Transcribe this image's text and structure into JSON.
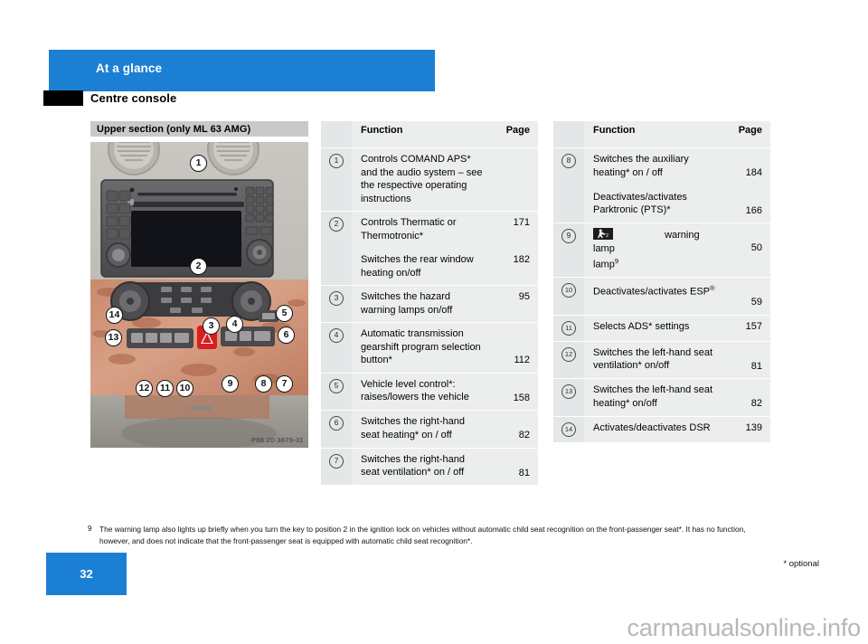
{
  "header": {
    "chapter_title": "At a glance",
    "section_title": "Centre console",
    "banner_color": "#1b7fd4"
  },
  "figure": {
    "caption": "Upper section (only ML 63 AMG)",
    "photo_code": "P68 20-3879-31",
    "callouts": [
      "1",
      "2",
      "3",
      "4",
      "5",
      "6",
      "7",
      "8",
      "9",
      "10",
      "11",
      "12",
      "13",
      "14"
    ]
  },
  "tables": {
    "columns": {
      "function": "Function",
      "page": "Page"
    },
    "left": [
      {
        "num": "1",
        "lines": [
          {
            "text": "Controls COMAND APS* and the audio system – see the respective operating instructions",
            "page": ""
          }
        ]
      },
      {
        "num": "2",
        "lines": [
          {
            "text": "Controls Thermatic or Thermotronic*",
            "page": "171"
          },
          {
            "text": "Switches the rear window heating on/off",
            "page": "182"
          }
        ]
      },
      {
        "num": "3",
        "lines": [
          {
            "text": "Switches the hazard warning lamps on/off",
            "page": "95"
          }
        ]
      },
      {
        "num": "4",
        "lines": [
          {
            "text": "Automatic transmission gearshift program selection button*",
            "page": "112"
          }
        ]
      },
      {
        "num": "5",
        "lines": [
          {
            "text": "Vehicle level control*: raises/lowers the vehicle",
            "page": "158"
          }
        ]
      },
      {
        "num": "6",
        "lines": [
          {
            "text": "Switches the right-hand seat heating* on / off",
            "page": "82"
          }
        ]
      },
      {
        "num": "7",
        "lines": [
          {
            "text": "Switches the right-hand seat ventilation* on / off",
            "page": "81"
          }
        ]
      }
    ],
    "right": [
      {
        "num": "8",
        "lines": [
          {
            "text": "Switches the auxiliary heating* on / off",
            "page": "184"
          },
          {
            "text": "Deactivates/activates Parktronic (PTS)*",
            "page": "166"
          }
        ]
      },
      {
        "num": "9",
        "icon": "child-seat-warning-lamp-icon",
        "lines": [
          {
            "text": "warning lamp",
            "footnote_mark": "9",
            "page": "50"
          }
        ]
      },
      {
        "num": "10",
        "lines": [
          {
            "text": "Deactivates/activates ESP",
            "registered": true,
            "page": "59"
          }
        ]
      },
      {
        "num": "11",
        "lines": [
          {
            "text": "Selects ADS* settings",
            "page": "157"
          }
        ]
      },
      {
        "num": "12",
        "lines": [
          {
            "text": "Switches the left-hand seat ventilation* on/off",
            "page": "81"
          }
        ]
      },
      {
        "num": "13",
        "lines": [
          {
            "text": "Switches the left-hand seat heating* on/off",
            "page": "82"
          }
        ]
      },
      {
        "num": "14",
        "lines": [
          {
            "text": "Activates/deactivates DSR",
            "page": "139"
          }
        ]
      }
    ]
  },
  "footnote": {
    "mark": "9",
    "text": "The warning lamp also lights up briefly when you turn the key to position 2 in the ignition lock on vehicles without automatic child seat recognition on the front-passenger seat*. It has no function, however, and does not indicate that the front-passenger seat is equipped with automatic child seat recognition*."
  },
  "footer": {
    "page_number": "32",
    "optional_note": "* optional",
    "watermark": "carmanualsonline.info"
  }
}
